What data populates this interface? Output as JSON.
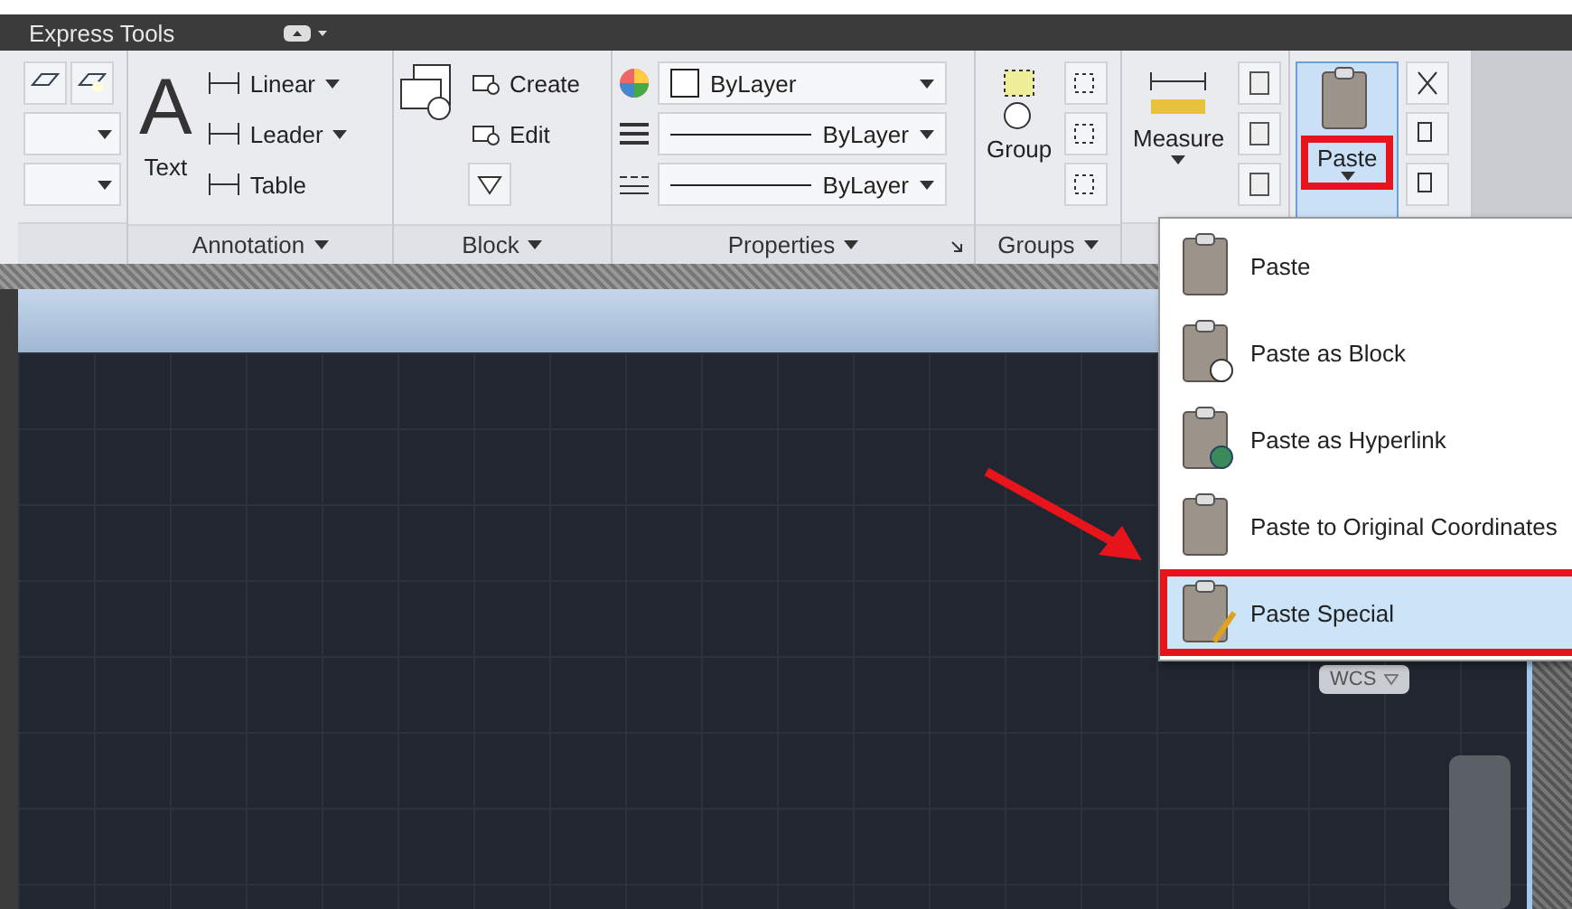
{
  "tab_bar": {
    "title": "Express Tools"
  },
  "ribbon": {
    "annotation": {
      "title": "Annotation",
      "big_icon": "A",
      "big_button": "Text",
      "tools": [
        {
          "label": "Linear",
          "dropdown": true
        },
        {
          "label": "Leader",
          "dropdown": true
        },
        {
          "label": "Table",
          "dropdown": false
        }
      ]
    },
    "block": {
      "title": "Block",
      "tools": [
        {
          "label": "Create"
        },
        {
          "label": "Edit"
        }
      ]
    },
    "properties": {
      "title": "Properties",
      "rows": [
        {
          "kind": "color",
          "value": "ByLayer"
        },
        {
          "kind": "lineweight",
          "value": "ByLayer"
        },
        {
          "kind": "linetype",
          "value": "ByLayer"
        }
      ]
    },
    "groups": {
      "title": "Groups",
      "big_button": "Group"
    },
    "utilities": {
      "big_button": "Measure"
    },
    "clipboard": {
      "big_button": "Paste",
      "expanded": true,
      "highlighted": true
    }
  },
  "paste_menu": [
    {
      "label": "Paste",
      "selected": false,
      "highlighted": false
    },
    {
      "label": "Paste as Block",
      "selected": false,
      "highlighted": false
    },
    {
      "label": "Paste as Hyperlink",
      "selected": false,
      "highlighted": false
    },
    {
      "label": "Paste to Original Coordinates",
      "selected": false,
      "highlighted": false
    },
    {
      "label": "Paste Special",
      "selected": true,
      "highlighted": true
    }
  ],
  "canvas": {
    "ucs_label": "WCS"
  }
}
